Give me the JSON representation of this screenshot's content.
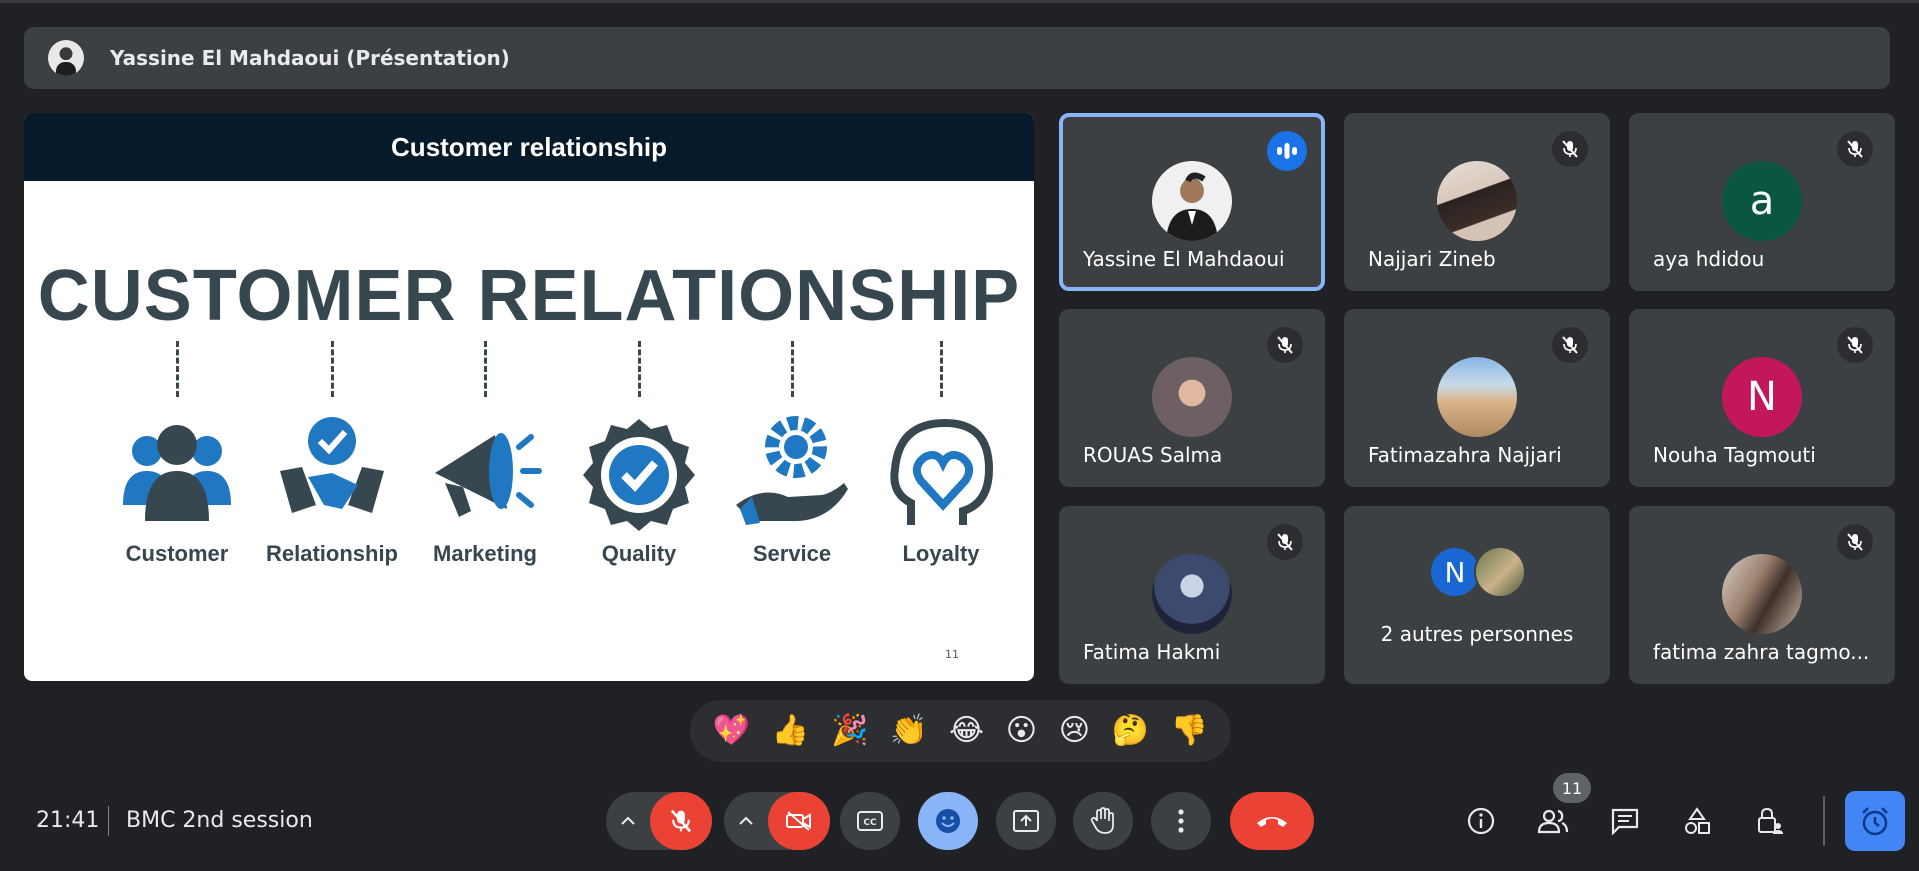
{
  "presenter": {
    "name": "Yassine El Mahdaoui (Présentation)"
  },
  "slide": {
    "header": "Customer relationship",
    "title": "CUSTOMER RELATIONSHIP",
    "concepts": [
      "Customer",
      "Relationship",
      "Marketing",
      "Quality",
      "Service",
      "Loyalty"
    ],
    "page_number": "11"
  },
  "participants": [
    {
      "name": "Yassine El Mahdaoui",
      "status": "speaking"
    },
    {
      "name": "Najjari Zineb",
      "status": "muted"
    },
    {
      "name": "aya hdidou",
      "initial": "a",
      "color": "#0b5543",
      "status": "muted"
    },
    {
      "name": "ROUAS Salma",
      "status": "muted"
    },
    {
      "name": "Fatimazahra Najjari",
      "status": "muted"
    },
    {
      "name": "Nouha Tagmouti",
      "initial": "N",
      "color": "#c2185b",
      "status": "muted"
    },
    {
      "name": "Fatima Hakmi",
      "status": "muted"
    },
    {
      "name": "2 autres personnes",
      "initial": "N",
      "color": "#1967d2"
    },
    {
      "name": "fatima zahra tagmo...",
      "status": "muted"
    }
  ],
  "reactions": [
    "💖",
    "👍",
    "🎉",
    "👏",
    "😂",
    "😮",
    "😢",
    "🤔",
    "👎"
  ],
  "bottom_bar": {
    "time": "21:41",
    "meeting_name": "BMC 2nd session",
    "participant_count": "11"
  },
  "colors": {
    "accent": "#8ab4f8",
    "danger": "#ea4335",
    "tile": "#3c4043",
    "background": "#202124"
  }
}
